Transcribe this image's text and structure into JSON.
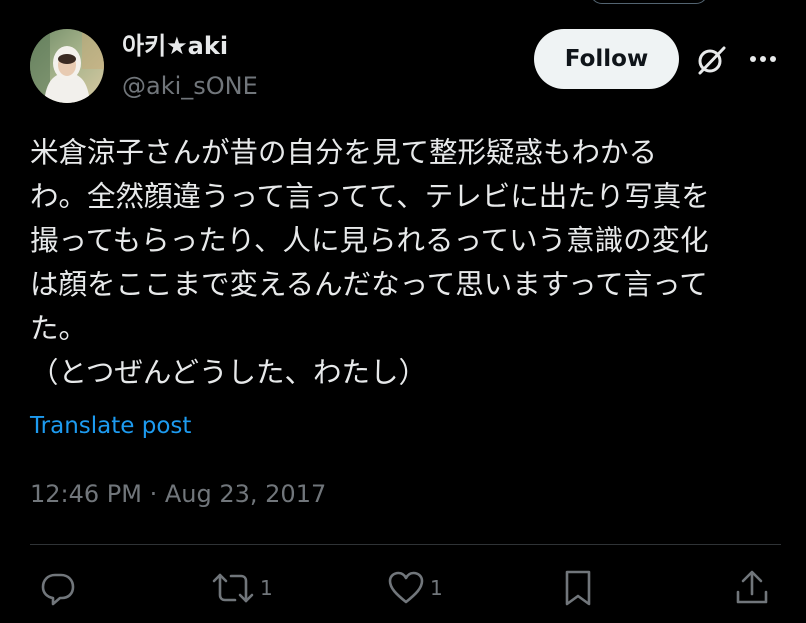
{
  "author": {
    "display_name": "아키★aki",
    "handle": "@aki_sONE"
  },
  "header": {
    "follow_label": "Follow"
  },
  "post": {
    "text_lines": [
      "米倉涼子さんが昔の自分を見て整形疑惑もわかる",
      "わ。全然顔違うって言ってて、テレビに出たり写真を",
      "撮ってもらったり、人に見られるっていう意識の変化",
      "は顔をここまで変えるんだなって思いますって言って",
      "た。",
      "（とつぜんどうした、わたし）"
    ],
    "translate_label": "Translate post",
    "timestamp": "12:46 PM · Aug 23, 2017"
  },
  "actions": {
    "replies": "",
    "reposts": "1",
    "likes": "1"
  },
  "icons": {
    "grok": "grok-icon",
    "more": "more-icon",
    "reply": "reply-icon",
    "repost": "repost-icon",
    "like": "heart-icon",
    "bookmark": "bookmark-icon",
    "share": "share-icon"
  },
  "colors": {
    "background": "#000000",
    "text": "#e7e9ea",
    "secondary": "#71767b",
    "link": "#1d9bf0",
    "follow_bg": "#eff3f4",
    "divider": "#2f3336"
  }
}
